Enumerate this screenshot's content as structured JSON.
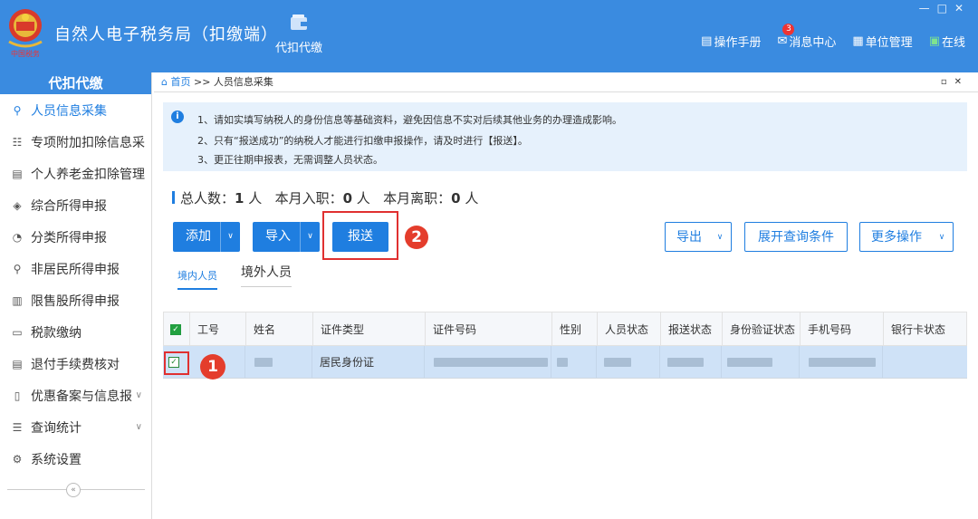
{
  "app": {
    "title": "自然人电子税务局（扣缴端）",
    "module_label": "代扣代缴",
    "toplinks": {
      "manual": "操作手册",
      "messages": "消息中心",
      "messages_badge": "3",
      "unit": "单位管理",
      "online": "在线"
    }
  },
  "sidebar": {
    "header": "代扣代缴",
    "items": [
      {
        "label": "人员信息采集",
        "icon": "person-icon"
      },
      {
        "label": "专项附加扣除信息采",
        "icon": "list-icon"
      },
      {
        "label": "个人养老金扣除管理",
        "icon": "document-icon"
      },
      {
        "label": "综合所得申报",
        "icon": "layers-icon"
      },
      {
        "label": "分类所得申报",
        "icon": "pie-icon"
      },
      {
        "label": "非居民所得申报",
        "icon": "person-icon"
      },
      {
        "label": "限售股所得申报",
        "icon": "bar-icon"
      },
      {
        "label": "税款缴纳",
        "icon": "wallet-icon"
      },
      {
        "label": "退付手续费核对",
        "icon": "receipt-icon"
      },
      {
        "label": "优惠备案与信息报",
        "icon": "card-icon"
      },
      {
        "label": "查询统计",
        "icon": "search-list-icon"
      },
      {
        "label": "系统设置",
        "icon": "gear-icon"
      }
    ]
  },
  "breadcrumb": {
    "home": "首页",
    "sep": ">>",
    "current": "人员信息采集"
  },
  "notice": {
    "lines": [
      "1、请如实填写纳税人的身份信息等基础资料，避免因信息不实对后续其他业务的办理造成影响。",
      "2、只有“报送成功”的纳税人才能进行扣缴申报操作，请及时进行【报送】。",
      "3、更正往期申报表，无需调整人员状态。"
    ]
  },
  "stats": {
    "total_label": "总人数：",
    "total": "1",
    "unit1": "人",
    "join_label": "本月入职：",
    "join": "0",
    "unit2": "人",
    "leave_label": "本月离职：",
    "leave": "0",
    "unit3": "人"
  },
  "toolbar": {
    "add": "添加",
    "import": "导入",
    "submit": "报送",
    "export": "导出",
    "expand_query": "展开查询条件",
    "more": "更多操作"
  },
  "annotations": {
    "step1": "1",
    "step2": "2"
  },
  "tabs": {
    "domestic": "境内人员",
    "foreign": "境外人员"
  },
  "table": {
    "columns": [
      "工号",
      "姓名",
      "证件类型",
      "证件号码",
      "性别",
      "人员状态",
      "报送状态",
      "身份验证状态",
      "手机号码",
      "银行卡状态"
    ],
    "rows": [
      {
        "id_type": "居民身份证"
      }
    ]
  },
  "colors": {
    "primary": "#1f7ee0",
    "titlebar": "#3a8be0",
    "highlight": "#e03030"
  }
}
